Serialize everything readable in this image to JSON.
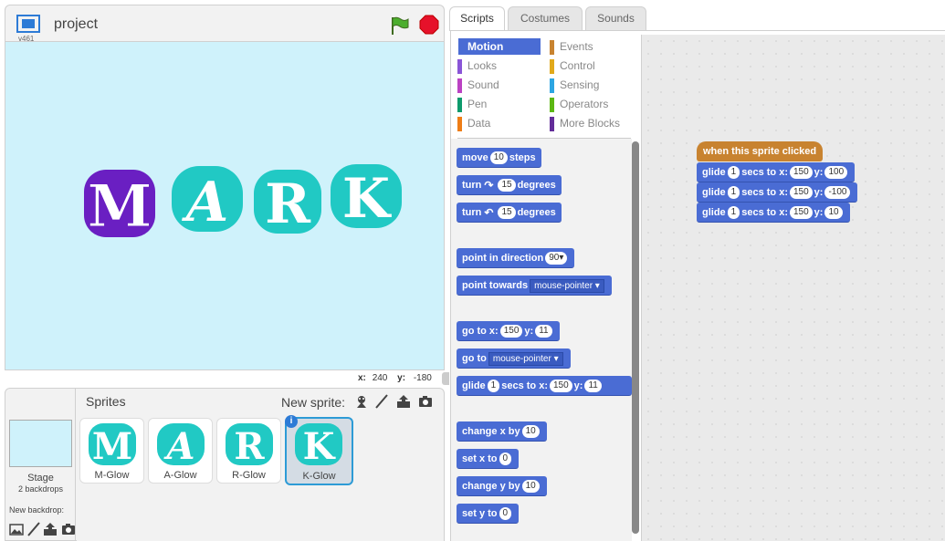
{
  "stage": {
    "version": "v461",
    "project_title": "project",
    "letters": [
      "M",
      "A",
      "R",
      "K"
    ],
    "coords": {
      "x_label": "x:",
      "x_value": "240",
      "y_label": "y:",
      "y_value": "-180"
    }
  },
  "sprites_pane": {
    "title": "Sprites",
    "new_sprite_label": "New sprite:",
    "stage_label": "Stage",
    "backdrops_count": "2 backdrops",
    "new_backdrop_label": "New backdrop:",
    "sprites": [
      {
        "letter": "M",
        "name": "M-Glow"
      },
      {
        "letter": "A",
        "name": "A-Glow"
      },
      {
        "letter": "R",
        "name": "R-Glow"
      },
      {
        "letter": "K",
        "name": "K-Glow"
      }
    ],
    "info_badge": "i"
  },
  "tabs": [
    "Scripts",
    "Costumes",
    "Sounds"
  ],
  "categories": {
    "left": [
      {
        "label": "Motion",
        "color": "#4a6cd4"
      },
      {
        "label": "Looks",
        "color": "#8a55d7"
      },
      {
        "label": "Sound",
        "color": "#bb42c3"
      },
      {
        "label": "Pen",
        "color": "#0e9a6c"
      },
      {
        "label": "Data",
        "color": "#ee7d16"
      }
    ],
    "right": [
      {
        "label": "Events",
        "color": "#c88330"
      },
      {
        "label": "Control",
        "color": "#e1a91a"
      },
      {
        "label": "Sensing",
        "color": "#2ca5e2"
      },
      {
        "label": "Operators",
        "color": "#5cb712"
      },
      {
        "label": "More Blocks",
        "color": "#632d99"
      }
    ]
  },
  "palette_blocks": {
    "move": {
      "pre": "move",
      "val": "10",
      "post": "steps"
    },
    "turn_cw": {
      "pre": "turn",
      "val": "15",
      "post": "degrees"
    },
    "turn_ccw": {
      "pre": "turn",
      "val": "15",
      "post": "degrees"
    },
    "point_dir": {
      "pre": "point in direction",
      "val": "90"
    },
    "point_towards": {
      "pre": "point towards",
      "val": "mouse-pointer"
    },
    "goto_xy": {
      "pre": "go to x:",
      "x": "150",
      "ylab": "y:",
      "y": "11"
    },
    "goto": {
      "pre": "go to",
      "val": "mouse-pointer"
    },
    "glide": {
      "pre": "glide",
      "secs": "1",
      "mid": "secs to x:",
      "x": "150",
      "ylab": "y:",
      "y": "11"
    },
    "change_x": {
      "pre": "change x by",
      "val": "10"
    },
    "set_x": {
      "pre": "set x to",
      "val": "0"
    },
    "change_y": {
      "pre": "change y by",
      "val": "10"
    },
    "set_y": {
      "pre": "set y to",
      "val": "0"
    }
  },
  "script": {
    "hat": "when this sprite clicked",
    "glides": [
      {
        "pre": "glide",
        "secs": "1",
        "mid": "secs to x:",
        "x": "150",
        "ylab": "y:",
        "y": "100"
      },
      {
        "pre": "glide",
        "secs": "1",
        "mid": "secs to x:",
        "x": "150",
        "ylab": "y:",
        "y": "-100"
      },
      {
        "pre": "glide",
        "secs": "1",
        "mid": "secs to x:",
        "x": "150",
        "ylab": "y:",
        "y": "10"
      }
    ]
  },
  "colors": {
    "motion": "#4a6cd4",
    "events": "#c88330",
    "stage_bg": "#cff2fb",
    "glow_teal": "#21c9c4",
    "glow_purple": "#6a1fc2"
  }
}
